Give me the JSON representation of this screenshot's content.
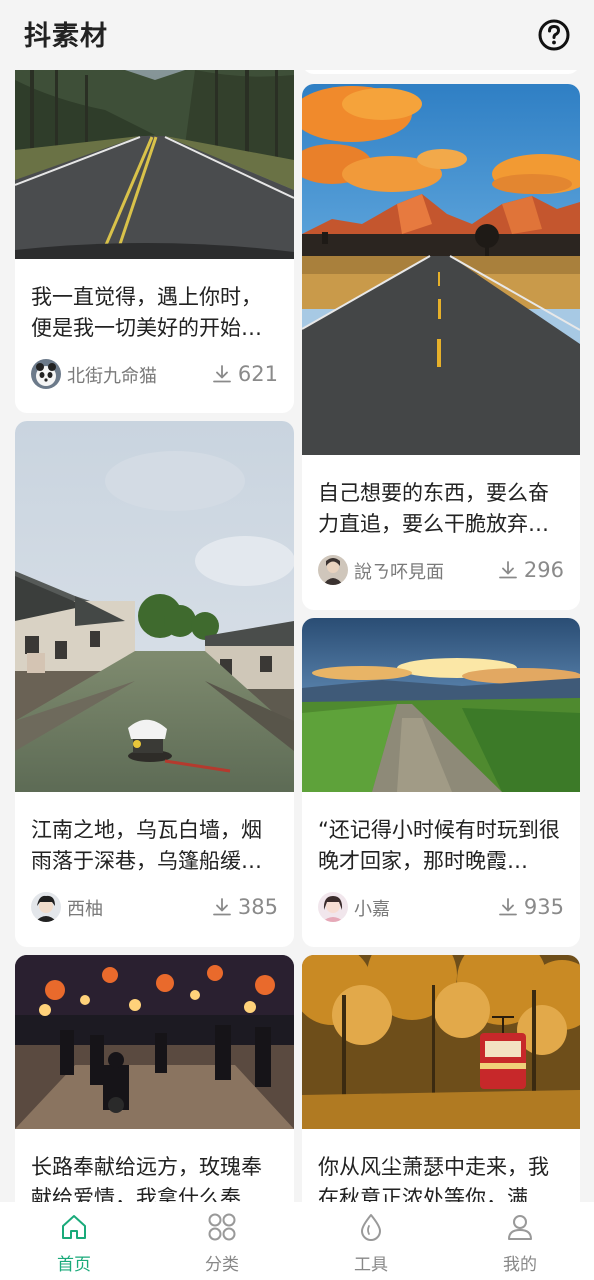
{
  "app": {
    "title": "抖素材"
  },
  "colors": {
    "accent": "#1aaa7a",
    "text": "#222222",
    "muted": "#888888"
  },
  "cards": [
    {
      "text": "",
      "author": "",
      "downloads": ""
    },
    {
      "text": "我一直觉得，遇上你时，便是我一切美好的开始…",
      "author": "北街九命猫",
      "downloads": "621"
    },
    {
      "text": "自己想要的东西，要么奋力直追，要么干脆放弃…",
      "author": "說ㄋ吥見面",
      "downloads": "296"
    },
    {
      "text": "江南之地，乌瓦白墙，烟雨落于深巷，乌篷船缓…",
      "author": "西柚",
      "downloads": "385"
    },
    {
      "text": "“还记得小时候有时玩到很晚才回家，那时晚霞…",
      "author": "小嘉",
      "downloads": "935"
    },
    {
      "text": "长路奉献给远方，玫瑰奉献给爱情，我拿什么奉…",
      "author": "",
      "downloads": ""
    },
    {
      "text": "你从风尘萧瑟中走来，我在秋意正浓处等你，满…",
      "author": "",
      "downloads": ""
    }
  ],
  "tabs": [
    {
      "label": "首页",
      "icon": "home-icon",
      "active": true
    },
    {
      "label": "分类",
      "icon": "grid-icon",
      "active": false
    },
    {
      "label": "工具",
      "icon": "drop-icon",
      "active": false
    },
    {
      "label": "我的",
      "icon": "user-icon",
      "active": false
    }
  ]
}
